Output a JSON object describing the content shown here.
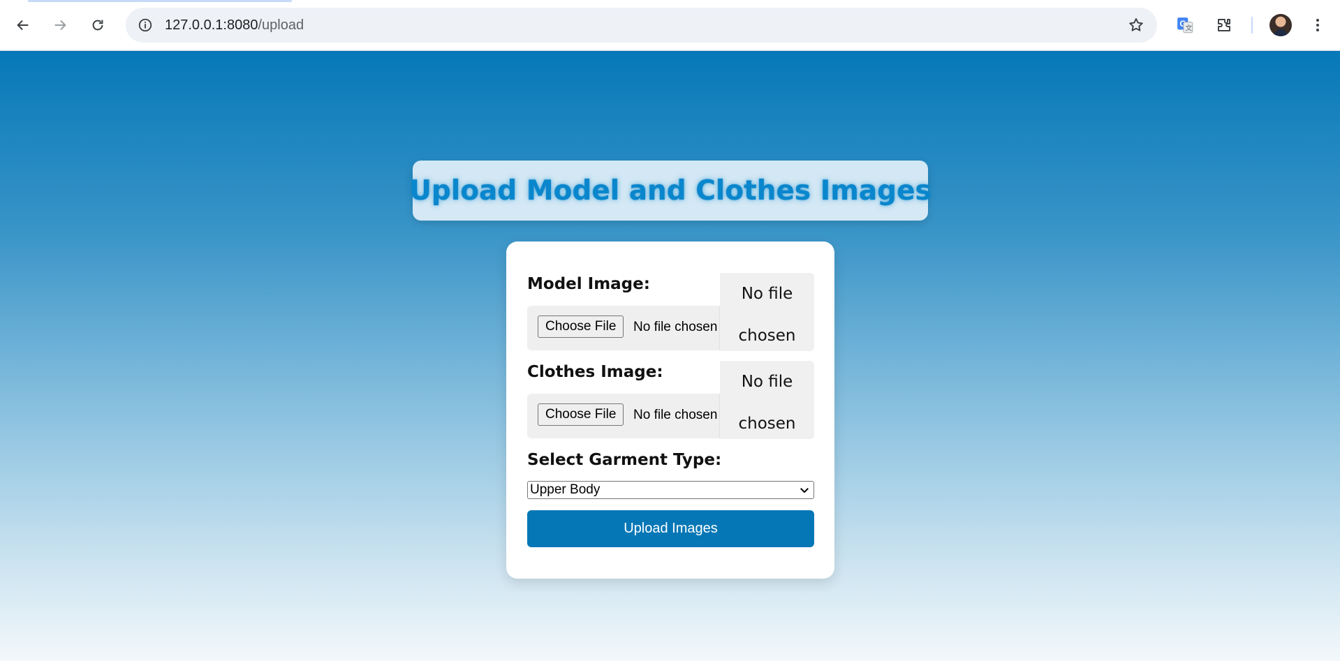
{
  "browser": {
    "url_host": "127.0.0.1:8080",
    "url_path": "/upload"
  },
  "page": {
    "title": "Upload Model and Clothes Images",
    "model": {
      "label": "Model Image:",
      "button": "Choose File",
      "status_inline": "No file chosen",
      "status_line1": "No file",
      "status_line2": "chosen"
    },
    "clothes": {
      "label": "Clothes Image:",
      "button": "Choose File",
      "status_inline": "No file chosen",
      "status_line1": "No file",
      "status_line2": "chosen"
    },
    "garment": {
      "label": "Select Garment Type:",
      "selected": "Upper Body"
    },
    "submit_label": "Upload Images"
  },
  "colors": {
    "accent": "#0677b6",
    "title_text": "#0a86cc"
  },
  "icons": [
    "back-arrow-icon",
    "forward-arrow-icon",
    "reload-icon",
    "site-info-icon",
    "bookmark-star-icon",
    "google-translate-icon",
    "extensions-icon",
    "profile-avatar",
    "more-menu-icon",
    "chevron-down-icon"
  ]
}
